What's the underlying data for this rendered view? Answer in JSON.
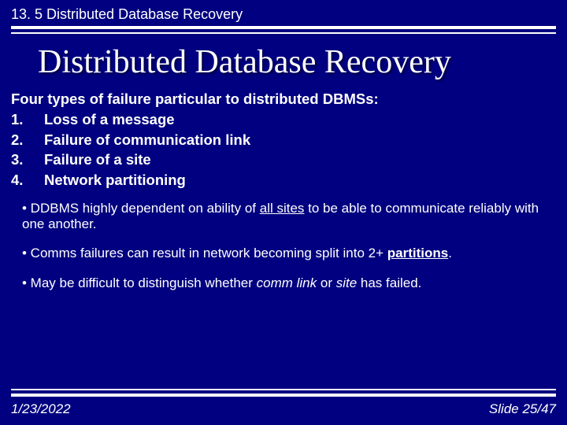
{
  "header": "13. 5 Distributed Database Recovery",
  "title": "Distributed Database Recovery",
  "intro": "Four types of failure particular to distributed DBMSs:",
  "list": [
    {
      "num": "1.",
      "text": "Loss of a message"
    },
    {
      "num": "2.",
      "text": "Failure of communication link"
    },
    {
      "num": "3.",
      "text": "Failure of a site"
    },
    {
      "num": "4.",
      "text": "Network partitioning"
    }
  ],
  "bullets": {
    "b1a": "• DDBMS highly dependent on ability of ",
    "b1u": "all sites",
    "b1b": " to be able to communicate reliably with one another.",
    "b2a": "• Comms failures can result in network becoming split into 2+ ",
    "b2b": "partitions",
    "b2c": ".",
    "b3a": "• May be difficult to distinguish whether ",
    "b3i1": "comm link",
    "b3b": " or ",
    "b3i2": "site",
    "b3c": " has failed."
  },
  "footer": {
    "date": "1/23/2022",
    "slide": "Slide 25/47"
  }
}
